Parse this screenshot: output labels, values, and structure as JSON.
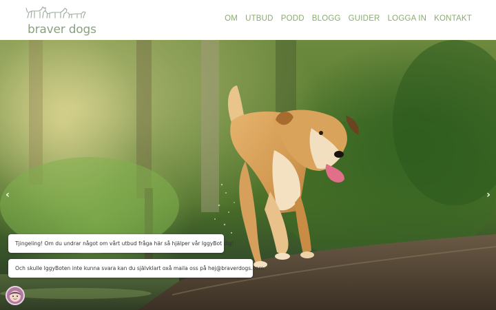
{
  "brand": {
    "name": "braver dogs",
    "logo_icon": "dogs-silhouette-logo",
    "color": "#8aa17f"
  },
  "nav": {
    "items": [
      {
        "label": "OM"
      },
      {
        "label": "UTBUD"
      },
      {
        "label": "PODD"
      },
      {
        "label": "BLOGG"
      },
      {
        "label": "GUIDER"
      },
      {
        "label": "LOGGA IN"
      },
      {
        "label": "KONTAKT"
      }
    ],
    "color": "#8aab6d"
  },
  "hero": {
    "image": "dog-running-on-forest-path-photo",
    "prev_icon": "chevron-left-icon",
    "next_icon": "chevron-right-icon"
  },
  "chat": {
    "messages": [
      {
        "text": "Tjingeling! Om du undrar något om vårt utbud fråga här så hjälper vår IggyBot dig!"
      },
      {
        "text": "Och skulle IggyBoten inte kunna svara kan du självklart oxå maila oss på hej@braverdogs.com."
      }
    ],
    "avatar_icon": "chatbot-avatar-icon"
  },
  "prev_glyph": "‹",
  "next_glyph": "›"
}
